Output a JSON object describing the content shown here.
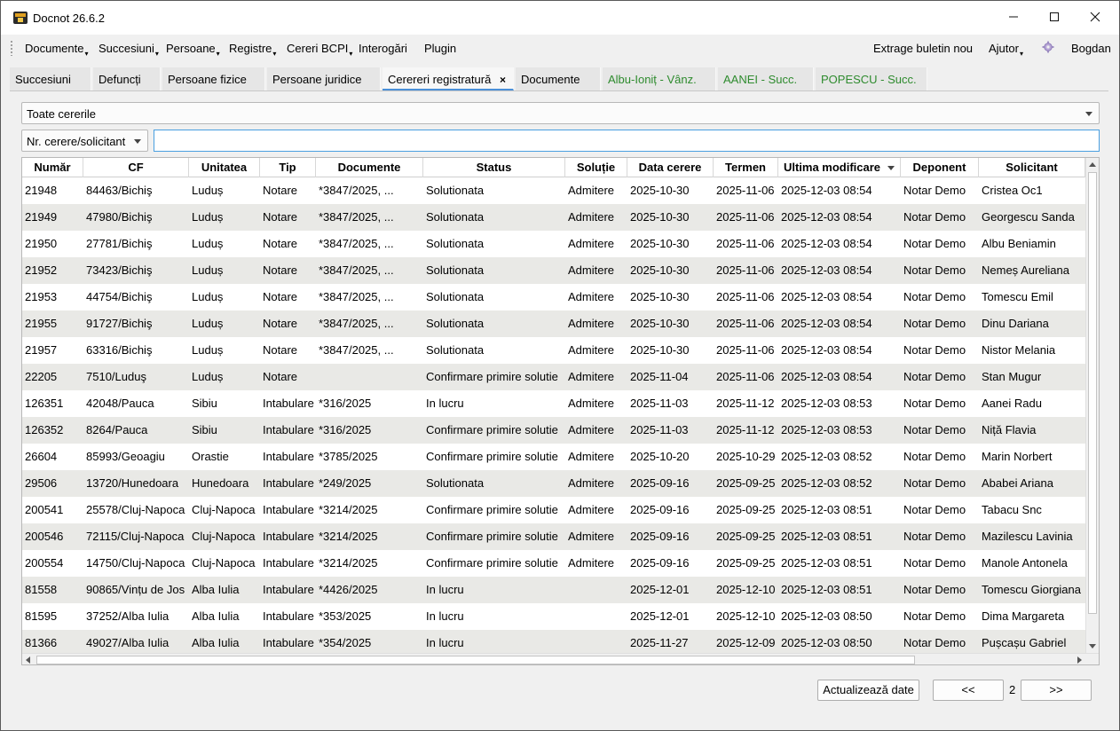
{
  "window": {
    "title": "Docnot 26.6.2"
  },
  "menubar": {
    "left": [
      {
        "label": "Documente",
        "has_arrow": true
      },
      {
        "label": "Succesiuni",
        "has_arrow": true
      },
      {
        "label": "Persoane",
        "has_arrow": true
      },
      {
        "label": "Registre",
        "has_arrow": true
      },
      {
        "label": "Cereri BCPI",
        "has_arrow": true
      },
      {
        "label": "Interogări",
        "has_arrow": false
      },
      {
        "label": "Plugin",
        "has_arrow": false
      }
    ],
    "extract_label": "Extrage buletin nou",
    "help_label": "Ajutor",
    "user_label": "Bogdan"
  },
  "tabs": [
    {
      "label": "Succesiuni"
    },
    {
      "label": "Defuncți"
    },
    {
      "label": "Persoane fizice"
    },
    {
      "label": "Persoane juridice"
    },
    {
      "label": "Cerereri registratură",
      "active": true,
      "closable": true
    },
    {
      "label": "Documente"
    },
    {
      "label": "Albu-Ioniț - Vânz.",
      "color": "green"
    },
    {
      "label": "AANEI - Succ.",
      "color": "green"
    },
    {
      "label": "POPESCU - Succ.",
      "color": "green"
    }
  ],
  "filter": {
    "selected": "Toate cererile"
  },
  "search": {
    "type_selected": "Nr. cerere/solicitant",
    "value": "",
    "placeholder": ""
  },
  "table": {
    "columns": [
      "Număr",
      "CF",
      "Unitatea",
      "Tip",
      "Documente",
      "Status",
      "Soluție",
      "Data cerere",
      "Termen",
      "Ultima modificare",
      "Deponent",
      "Solicitant"
    ],
    "sorted_column": "Ultima modificare",
    "rows": [
      [
        "21948",
        "84463/Bichiş",
        "Luduș",
        "Notare",
        "*3847/2025, ...",
        "Solutionata",
        "Admitere",
        "2025-10-30",
        "2025-11-06",
        "2025-12-03 08:54",
        "Notar Demo",
        "Cristea Oc1"
      ],
      [
        "21949",
        "47980/Bichiş",
        "Luduș",
        "Notare",
        "*3847/2025, ...",
        "Solutionata",
        "Admitere",
        "2025-10-30",
        "2025-11-06",
        "2025-12-03 08:54",
        "Notar Demo",
        "Georgescu Sanda"
      ],
      [
        "21950",
        "27781/Bichiş",
        "Luduș",
        "Notare",
        "*3847/2025, ...",
        "Solutionata",
        "Admitere",
        "2025-10-30",
        "2025-11-06",
        "2025-12-03 08:54",
        "Notar Demo",
        "Albu Beniamin"
      ],
      [
        "21952",
        "73423/Bichiş",
        "Luduș",
        "Notare",
        "*3847/2025, ...",
        "Solutionata",
        "Admitere",
        "2025-10-30",
        "2025-11-06",
        "2025-12-03 08:54",
        "Notar Demo",
        "Nemeș Aureliana"
      ],
      [
        "21953",
        "44754/Bichiş",
        "Luduș",
        "Notare",
        "*3847/2025, ...",
        "Solutionata",
        "Admitere",
        "2025-10-30",
        "2025-11-06",
        "2025-12-03 08:54",
        "Notar Demo",
        "Tomescu Emil"
      ],
      [
        "21955",
        "91727/Bichiş",
        "Luduș",
        "Notare",
        "*3847/2025, ...",
        "Solutionata",
        "Admitere",
        "2025-10-30",
        "2025-11-06",
        "2025-12-03 08:54",
        "Notar Demo",
        "Dinu Dariana"
      ],
      [
        "21957",
        "63316/Bichiş",
        "Luduș",
        "Notare",
        "*3847/2025, ...",
        "Solutionata",
        "Admitere",
        "2025-10-30",
        "2025-11-06",
        "2025-12-03 08:54",
        "Notar Demo",
        "Nistor Melania"
      ],
      [
        "22205",
        "7510/Luduş",
        "Luduș",
        "Notare",
        "",
        "Confirmare primire solutie",
        "Admitere",
        "2025-11-04",
        "2025-11-06",
        "2025-12-03 08:54",
        "Notar Demo",
        "Stan Mugur"
      ],
      [
        "126351",
        "42048/Pauca",
        "Sibiu",
        "Intabulare",
        "*316/2025",
        "In lucru",
        "Admitere",
        "2025-11-03",
        "2025-11-12",
        "2025-12-03 08:53",
        "Notar Demo",
        "Aanei Radu"
      ],
      [
        "126352",
        "8264/Pauca",
        "Sibiu",
        "Intabulare",
        "*316/2025",
        "Confirmare primire solutie",
        "Admitere",
        "2025-11-03",
        "2025-11-12",
        "2025-12-03 08:53",
        "Notar Demo",
        "Niță Flavia"
      ],
      [
        "26604",
        "85993/Geoagiu",
        "Orastie",
        "Intabulare",
        "*3785/2025",
        "Confirmare primire solutie",
        "Admitere",
        "2025-10-20",
        "2025-10-29",
        "2025-12-03 08:52",
        "Notar Demo",
        "Marin Norbert"
      ],
      [
        "29506",
        "13720/Hunedoara",
        "Hunedoara",
        "Intabulare",
        "*249/2025",
        "Solutionata",
        "Admitere",
        "2025-09-16",
        "2025-09-25",
        "2025-12-03 08:52",
        "Notar Demo",
        "Ababei Ariana"
      ],
      [
        "200541",
        "25578/Cluj-Napoca",
        "Cluj-Napoca",
        "Intabulare",
        "*3214/2025",
        "Confirmare primire solutie",
        "Admitere",
        "2025-09-16",
        "2025-09-25",
        "2025-12-03 08:51",
        "Notar Demo",
        "Tabacu Snc"
      ],
      [
        "200546",
        "72115/Cluj-Napoca",
        "Cluj-Napoca",
        "Intabulare",
        "*3214/2025",
        "Confirmare primire solutie",
        "Admitere",
        "2025-09-16",
        "2025-09-25",
        "2025-12-03 08:51",
        "Notar Demo",
        "Mazilescu Lavinia"
      ],
      [
        "200554",
        "14750/Cluj-Napoca",
        "Cluj-Napoca",
        "Intabulare",
        "*3214/2025",
        "Confirmare primire solutie",
        "Admitere",
        "2025-09-16",
        "2025-09-25",
        "2025-12-03 08:51",
        "Notar Demo",
        "Manole Antonela"
      ],
      [
        "81558",
        "90865/Vințu de Jos",
        "Alba Iulia",
        "Intabulare",
        "*4426/2025",
        "In lucru",
        "",
        "2025-12-01",
        "2025-12-10",
        "2025-12-03 08:51",
        "Notar Demo",
        "Tomescu Giorgiana"
      ],
      [
        "81595",
        "37252/Alba Iulia",
        "Alba Iulia",
        "Intabulare",
        "*353/2025",
        "In lucru",
        "",
        "2025-12-01",
        "2025-12-10",
        "2025-12-03 08:50",
        "Notar Demo",
        "Dima Margareta"
      ],
      [
        "81366",
        "49027/Alba Iulia",
        "Alba Iulia",
        "Intabulare",
        "*354/2025",
        "In lucru",
        "",
        "2025-11-27",
        "2025-12-09",
        "2025-12-03 08:50",
        "Notar Demo",
        "Pușcașu Gabriel"
      ]
    ]
  },
  "footer": {
    "refresh_label": "Actualizează date",
    "prev_label": "<<",
    "page": "2",
    "next_label": ">>"
  }
}
